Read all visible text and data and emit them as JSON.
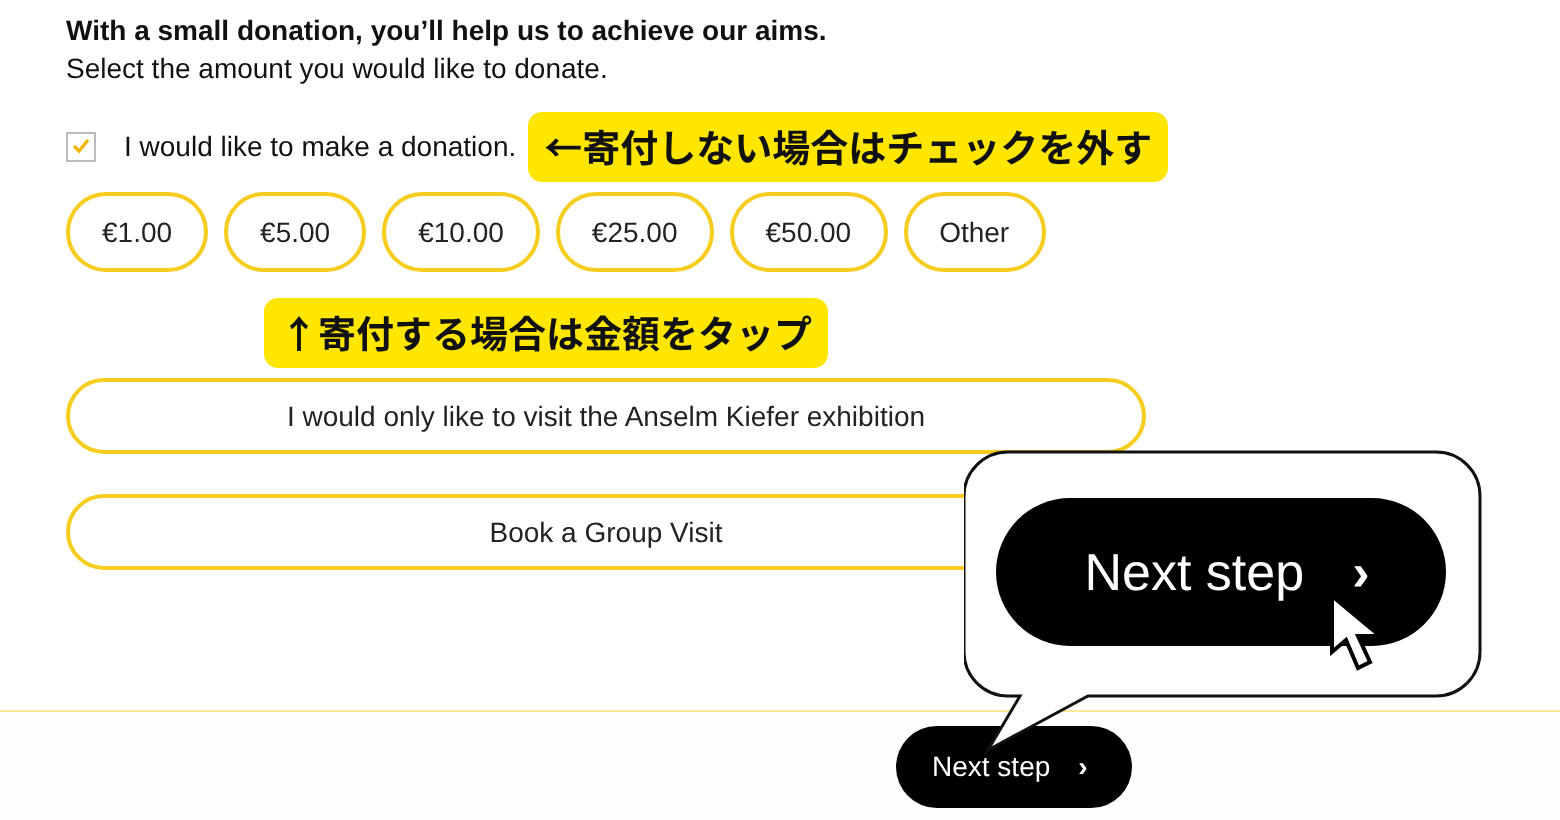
{
  "heading": "With a small donation, you’ll help us to achieve our aims.",
  "subtitle": "Select the amount you would like to donate.",
  "donation_checkbox": {
    "label": "I would like to make a donation.",
    "checked": true
  },
  "annotations": [
    {
      "text": "←寄付しない場合はチェックを外す"
    },
    {
      "text": "↑寄付する場合は金額をタップ"
    }
  ],
  "amounts": [
    "€1.00",
    "€5.00",
    "€10.00",
    "€25.00",
    "€50.00",
    "Other"
  ],
  "options": [
    "I would only like to visit the Anselm Kiefer exhibition",
    "Book a Group Visit"
  ],
  "next_step": {
    "label": "Next step",
    "icon": "›"
  },
  "callout": {
    "label": "Next step",
    "icon": "›"
  }
}
